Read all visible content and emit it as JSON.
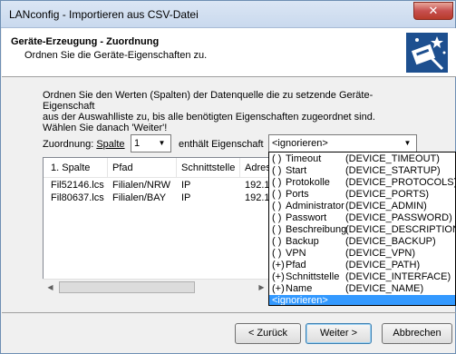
{
  "window": {
    "title": "LANconfig - Importieren aus CSV-Datei",
    "close_glyph": "✕"
  },
  "header": {
    "title": "Geräte-Erzeugung - Zuordnung",
    "subtitle": "Ordnen Sie die Geräte-Eigenschaften zu.",
    "icon": "wizard-icon"
  },
  "instructions": {
    "line1": "Ordnen Sie den Werten (Spalten) der Datenquelle die zu setzende Geräte-Eigenschaft",
    "line2": "aus der Auswahlliste zu, bis alle benötigten Eigenschaften zugeordnet sind.",
    "line3": "Wählen Sie danach 'Weiter'!"
  },
  "mapping": {
    "label_prefix": "Zuordnung: ",
    "label_spalte": "Spalte",
    "column_value": "1",
    "property_label": "enthält Eigenschaft",
    "property_value": "<ignorieren>"
  },
  "table": {
    "columns": [
      "1. Spalte",
      "Pfad",
      "Schnittstelle",
      "Adres"
    ],
    "rows": [
      [
        "Fil52146.lcs",
        "Filialen/NRW",
        "IP",
        "192.1"
      ],
      [
        "Fil80637.lcs",
        "Filialen/BAY",
        "IP",
        "192.1"
      ]
    ]
  },
  "dropdown": {
    "items": [
      {
        "flag": "( )",
        "name": "Timeout",
        "code": "(DEVICE_TIMEOUT)"
      },
      {
        "flag": "( )",
        "name": "Start",
        "code": "(DEVICE_STARTUP)"
      },
      {
        "flag": "( )",
        "name": "Protokolle",
        "code": "(DEVICE_PROTOCOLS)"
      },
      {
        "flag": "( )",
        "name": "Ports",
        "code": "(DEVICE_PORTS)"
      },
      {
        "flag": "( )",
        "name": "Administrator",
        "code": "(DEVICE_ADMIN)"
      },
      {
        "flag": "( )",
        "name": "Passwort",
        "code": "(DEVICE_PASSWORD)"
      },
      {
        "flag": "( )",
        "name": "Beschreibung",
        "code": "(DEVICE_DESCRIPTION)"
      },
      {
        "flag": "( )",
        "name": "Backup",
        "code": "(DEVICE_BACKUP)"
      },
      {
        "flag": "( )",
        "name": "VPN",
        "code": "(DEVICE_VPN)"
      },
      {
        "flag": "(+)",
        "name": "Pfad",
        "code": "(DEVICE_PATH)"
      },
      {
        "flag": "(+)",
        "name": "Schnittstelle",
        "code": "(DEVICE_INTERFACE)"
      },
      {
        "flag": "(+)",
        "name": "Name",
        "code": "(DEVICE_NAME)"
      },
      {
        "flag": "",
        "name": "<ignorieren>",
        "code": ""
      }
    ],
    "selected_index": 12
  },
  "buttons": {
    "back": "< Zurück",
    "next": "Weiter >",
    "cancel": "Abbrechen"
  },
  "colors": {
    "selection": "#3399ff",
    "header_icon_bg": "#1d4f8f"
  }
}
